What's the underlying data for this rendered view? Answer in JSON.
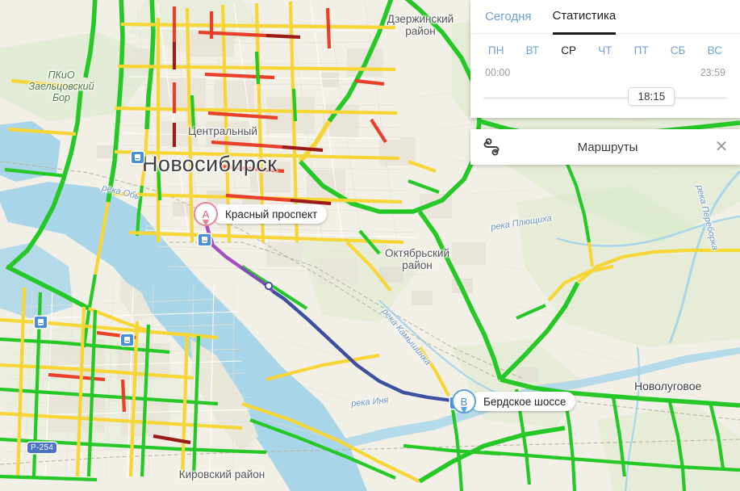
{
  "stats_panel": {
    "tabs": [
      {
        "label": "Сегодня",
        "active": false
      },
      {
        "label": "Статистика",
        "active": true
      }
    ],
    "days": [
      {
        "label": "ПН",
        "active": false
      },
      {
        "label": "ВТ",
        "active": false
      },
      {
        "label": "СР",
        "active": true
      },
      {
        "label": "ЧТ",
        "active": false
      },
      {
        "label": "ПТ",
        "active": false
      },
      {
        "label": "СБ",
        "active": false
      },
      {
        "label": "ВС",
        "active": false
      }
    ],
    "time_start": "00:00",
    "time_end": "23:59",
    "slider_value": "18:15"
  },
  "routes_bar": {
    "icon": "route-icon",
    "title": "Маршруты",
    "close": "✕"
  },
  "route": {
    "start": {
      "badge": "A",
      "label": "Красный проспект"
    },
    "end": {
      "badge": "B",
      "label": "Бердское шоссе"
    }
  },
  "map_labels": {
    "city": "Новосибирск",
    "park": "ПКиО\nЗаельцовский\nБор",
    "park_l1": "ПКиО",
    "park_l2": "Заельцовский",
    "park_l3": "Бор",
    "districts": [
      {
        "l1": "Дзержинский",
        "l2": "район"
      },
      {
        "l1": "Центральный",
        "l2": ""
      },
      {
        "l1": "Октябрьский",
        "l2": "район"
      },
      {
        "l1": "Кировский район",
        "l2": ""
      }
    ],
    "town": "Новолуговое",
    "rivers": [
      "река Обь",
      "река Плющиха",
      "река Камышинка",
      "река Иня",
      "река Переборка"
    ],
    "road_shield": "Р-254"
  },
  "colors": {
    "traffic_green": "#26c828",
    "traffic_yellow": "#f6d536",
    "traffic_red": "#e8402a",
    "traffic_darkred": "#9b1b1b",
    "route_blue": "#3f4fa0",
    "route_violet": "#a44fc0",
    "water": "#a9d5e8",
    "land": "#f2efe6",
    "green_area": "#d4e7c4",
    "accent_link": "#6ea0d8"
  }
}
